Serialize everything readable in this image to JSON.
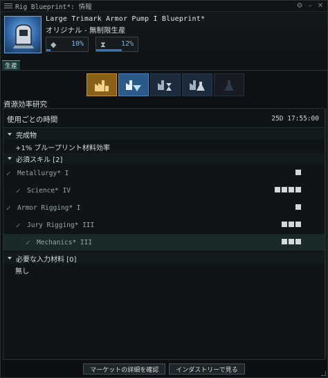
{
  "window": {
    "title": "Rig Blueprint*: 情報"
  },
  "blueprint": {
    "name": "Large Trimark Armor Pump I Blueprint*",
    "type_line": "オリジナル - 無制限生産",
    "stats": [
      {
        "icon": "gem-icon",
        "label": "10%",
        "progress": 0.1
      },
      {
        "icon": "hourglass-icon",
        "label": "12%",
        "progress": 0.61
      }
    ]
  },
  "tabs": [
    {
      "label": "生産"
    }
  ],
  "activities": [
    {
      "name": "manufacturing",
      "state": "selected"
    },
    {
      "name": "material-efficiency-research",
      "state": "active"
    },
    {
      "name": "time-efficiency-research",
      "state": "dim"
    },
    {
      "name": "copying",
      "state": "dim"
    },
    {
      "name": "invention",
      "state": "disabled"
    }
  ],
  "section_title": "資源効率研究",
  "time": {
    "label": "使用ごとの時間",
    "value": "25D 17:55:00"
  },
  "outcome": {
    "header": "完成物",
    "text": "+1% ブループリント材料効率"
  },
  "skills": {
    "header": "必須スキル [2]",
    "items": [
      {
        "name": "Metallurgy* I",
        "indent": 0,
        "levels": 1
      },
      {
        "name": "Science* IV",
        "indent": 1,
        "levels": 4
      },
      {
        "name": "Armor Rigging* I",
        "indent": 0,
        "levels": 1
      },
      {
        "name": "Jury Rigging* III",
        "indent": 1,
        "levels": 3
      },
      {
        "name": "Mechanics* III",
        "indent": 2,
        "levels": 3
      }
    ]
  },
  "inputs": {
    "header": "必要な入力材料 [0]",
    "text": "無し"
  },
  "footer": {
    "market_button": "マーケットの詳細を確認",
    "industry_button": "インダストリーで見る"
  },
  "colors": {
    "accent": "#2c78c8",
    "selected_activity": "#8a6118",
    "active_activity": "#2c5a88"
  }
}
